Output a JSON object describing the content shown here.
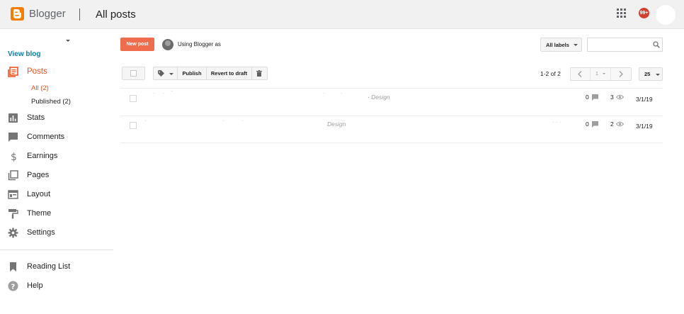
{
  "header": {
    "brand": "Blogger",
    "title": "All posts",
    "notification_count": "99+"
  },
  "sidebar": {
    "view_blog": "View blog",
    "items": [
      {
        "label": "Posts",
        "icon": "posts-icon",
        "active": true
      },
      {
        "label": "Stats",
        "icon": "bar-chart-icon"
      },
      {
        "label": "Comments",
        "icon": "comment-icon"
      },
      {
        "label": "Earnings",
        "icon": "dollar-icon"
      },
      {
        "label": "Pages",
        "icon": "pages-icon"
      },
      {
        "label": "Layout",
        "icon": "layout-icon"
      },
      {
        "label": "Theme",
        "icon": "paint-roller-icon"
      },
      {
        "label": "Settings",
        "icon": "gear-icon"
      }
    ],
    "sub_items": [
      {
        "label": "All (2)",
        "active": true
      },
      {
        "label": "Published (2)"
      }
    ],
    "bottom_items": [
      {
        "label": "Reading List",
        "icon": "bookmark-icon"
      },
      {
        "label": "Help",
        "icon": "help-icon"
      }
    ]
  },
  "toolbar": {
    "new_post": "New post",
    "using_as": "Using Blogger as",
    "labels_dropdown": "All labels",
    "search_placeholder": "",
    "publish": "Publish",
    "revert": "Revert to draft",
    "page_range": "1-2 of 2",
    "current_page": "1",
    "per_page": "25"
  },
  "posts": [
    {
      "label": "Design",
      "comments": "0",
      "views": "3",
      "date": "3/1/19"
    },
    {
      "label": "Design",
      "comments": "0",
      "views": "2",
      "date": "3/1/19"
    }
  ],
  "colors": {
    "accent": "#f4511e",
    "brand": "#f57d00",
    "link": "#0f7fa8",
    "header_bg": "#f1f1f1",
    "new_post_bg": "#ef6c4c"
  }
}
